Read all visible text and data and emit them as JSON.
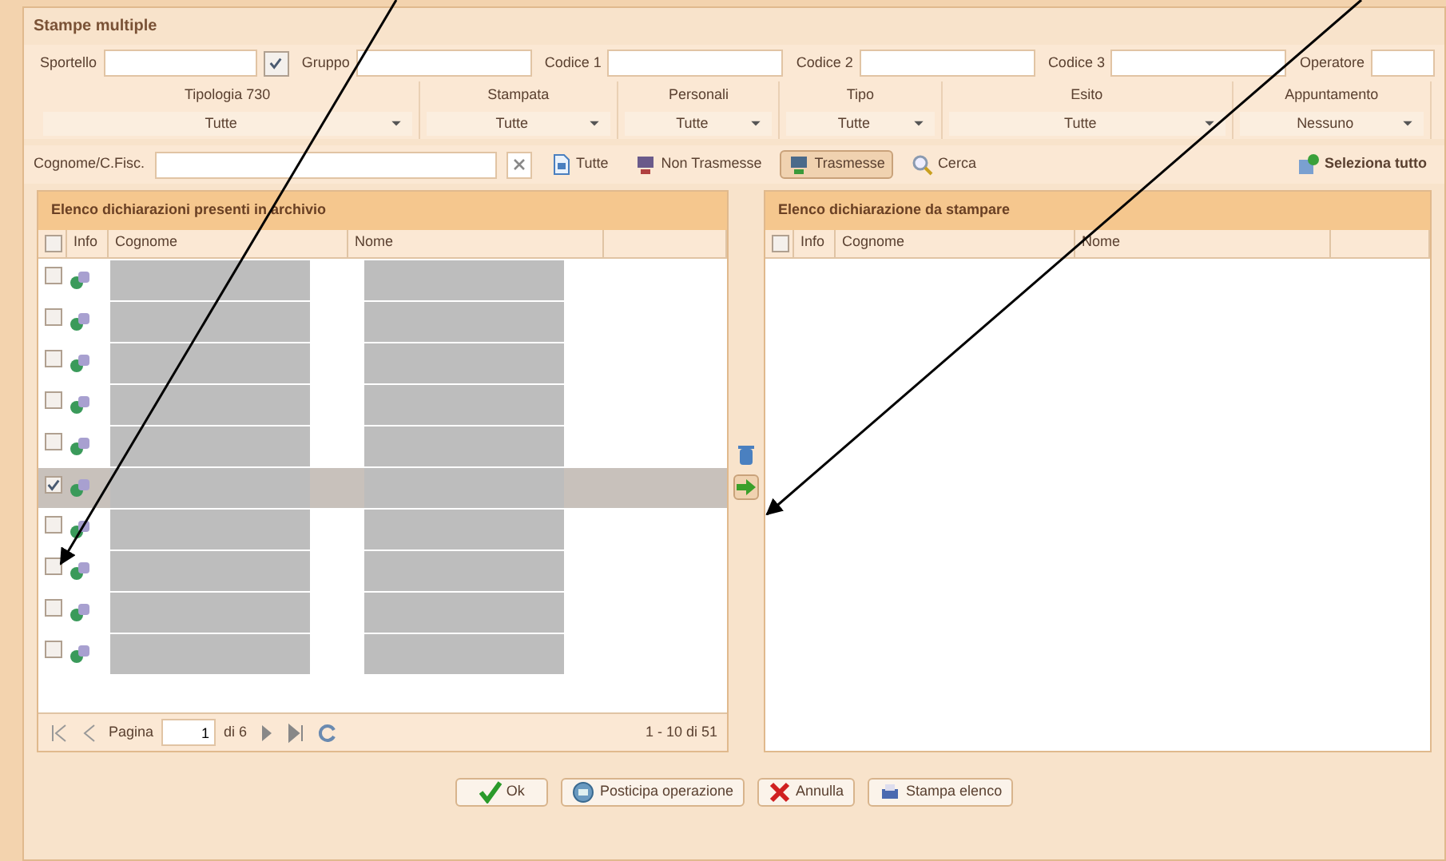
{
  "window": {
    "title": "Stampe multiple"
  },
  "top_fields": [
    {
      "label": "Sportello"
    },
    {
      "label": "Gruppo",
      "checkbox_checked": true
    },
    {
      "label": "Codice 1"
    },
    {
      "label": "Codice 2"
    },
    {
      "label": "Codice 3"
    },
    {
      "label": "Operatore"
    }
  ],
  "filters": [
    {
      "label": "Tipologia 730",
      "value": "Tutte"
    },
    {
      "label": "Stampata",
      "value": "Tutte"
    },
    {
      "label": "Personali",
      "value": "Tutte"
    },
    {
      "label": "Tipo",
      "value": "Tutte"
    },
    {
      "label": "Esito",
      "value": "Tutte"
    },
    {
      "label": "Appuntamento",
      "value": "Nessuno"
    }
  ],
  "search": {
    "label": "Cognome/C.Fisc."
  },
  "toolbar": [
    {
      "label": "Tutte",
      "kind": "doc",
      "selected": false
    },
    {
      "label": "Non Trasmesse",
      "kind": "pc-red",
      "selected": false
    },
    {
      "label": "Trasmesse",
      "kind": "pc-green",
      "selected": true
    },
    {
      "label": "Cerca",
      "kind": "search",
      "selected": false
    }
  ],
  "select_all": {
    "label": "Seleziona tutto"
  },
  "left_grid": {
    "title": "Elenco dichiarazioni presenti in archivio",
    "header_checked": false,
    "columns": [
      "Info",
      "Cognome",
      "Nome"
    ],
    "rows": [
      {
        "checked": false,
        "selected": false
      },
      {
        "checked": false,
        "selected": false
      },
      {
        "checked": false,
        "selected": false
      },
      {
        "checked": false,
        "selected": false
      },
      {
        "checked": false,
        "selected": false
      },
      {
        "checked": true,
        "selected": true
      },
      {
        "checked": false,
        "selected": false
      },
      {
        "checked": false,
        "selected": false
      },
      {
        "checked": false,
        "selected": false
      },
      {
        "checked": false,
        "selected": false
      }
    ],
    "pager": {
      "label": "Pagina",
      "page": "1",
      "of": "di 6",
      "summary": "1 - 10 di 51"
    }
  },
  "right_grid": {
    "title": "Elenco dichiarazione da stampare",
    "header_checked": false,
    "columns": [
      "Info",
      "Cognome",
      "Nome"
    ]
  },
  "buttons": [
    {
      "label": "Ok",
      "kind": "ok"
    },
    {
      "label": "Posticipa operazione",
      "kind": "later"
    },
    {
      "label": "Annulla",
      "kind": "cancel"
    },
    {
      "label": "Stampa elenco",
      "kind": "print"
    }
  ]
}
